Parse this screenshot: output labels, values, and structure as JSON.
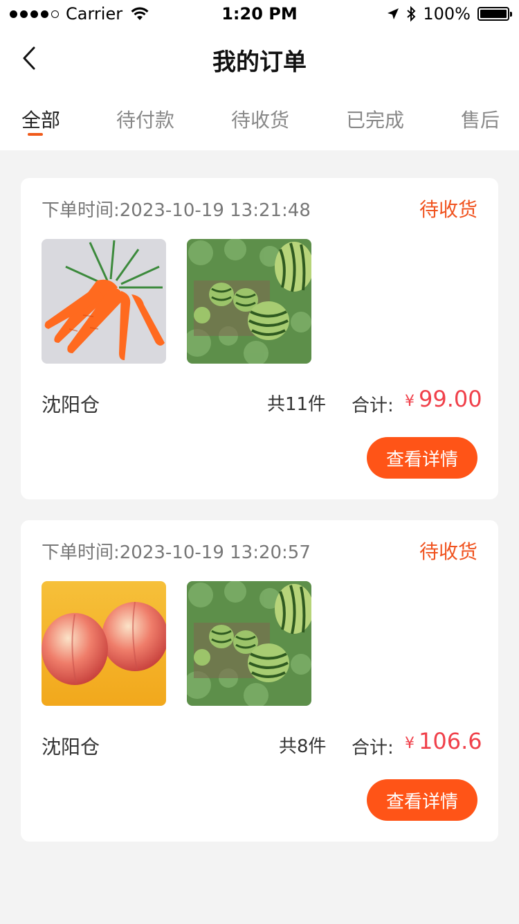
{
  "status_bar": {
    "carrier": "Carrier",
    "time": "1:20 PM",
    "battery": "100%"
  },
  "nav": {
    "title": "我的订单"
  },
  "tabs": [
    {
      "label": "全部"
    },
    {
      "label": "待付款"
    },
    {
      "label": "待收货"
    },
    {
      "label": "已完成"
    },
    {
      "label": "售后"
    }
  ],
  "orders": [
    {
      "time": "下单时间:2023-10-19 13:21:48",
      "status": "待收货",
      "warehouse": "沈阳仓",
      "count": "共11件",
      "total_label": "合计:",
      "currency": "¥",
      "amount": "99.00",
      "button": "查看详情",
      "items": [
        "carrot",
        "watermelon"
      ]
    },
    {
      "time": "下单时间:2023-10-19 13:20:57",
      "status": "待收货",
      "warehouse": "沈阳仓",
      "count": "共8件",
      "total_label": "合计:",
      "currency": "¥",
      "amount": "106.6",
      "button": "查看详情",
      "items": [
        "peach",
        "watermelon"
      ]
    }
  ],
  "colors": {
    "accent": "#f0521e",
    "price": "#f0404a",
    "button": "#ff5417",
    "background": "#f3f3f3"
  }
}
